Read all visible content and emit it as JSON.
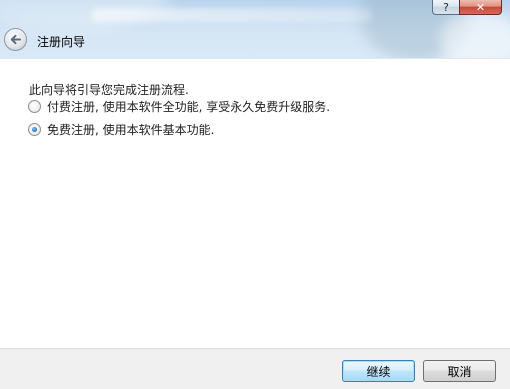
{
  "window": {
    "title": "注册向导",
    "help_glyph": "?",
    "close_glyph": "✕"
  },
  "content": {
    "intro": "此向导将引导您完成注册流程.",
    "options": [
      {
        "label": "付费注册, 使用本软件全功能, 享受永久免费升级服务.",
        "checked": false
      },
      {
        "label": "免费注册, 使用本软件基本功能.",
        "checked": true
      }
    ]
  },
  "footer": {
    "next_label": "继续",
    "cancel_label": "取消"
  },
  "colors": {
    "frame": "#c9def1",
    "default_button": "#bee6fd",
    "close_button": "#c8483a"
  }
}
